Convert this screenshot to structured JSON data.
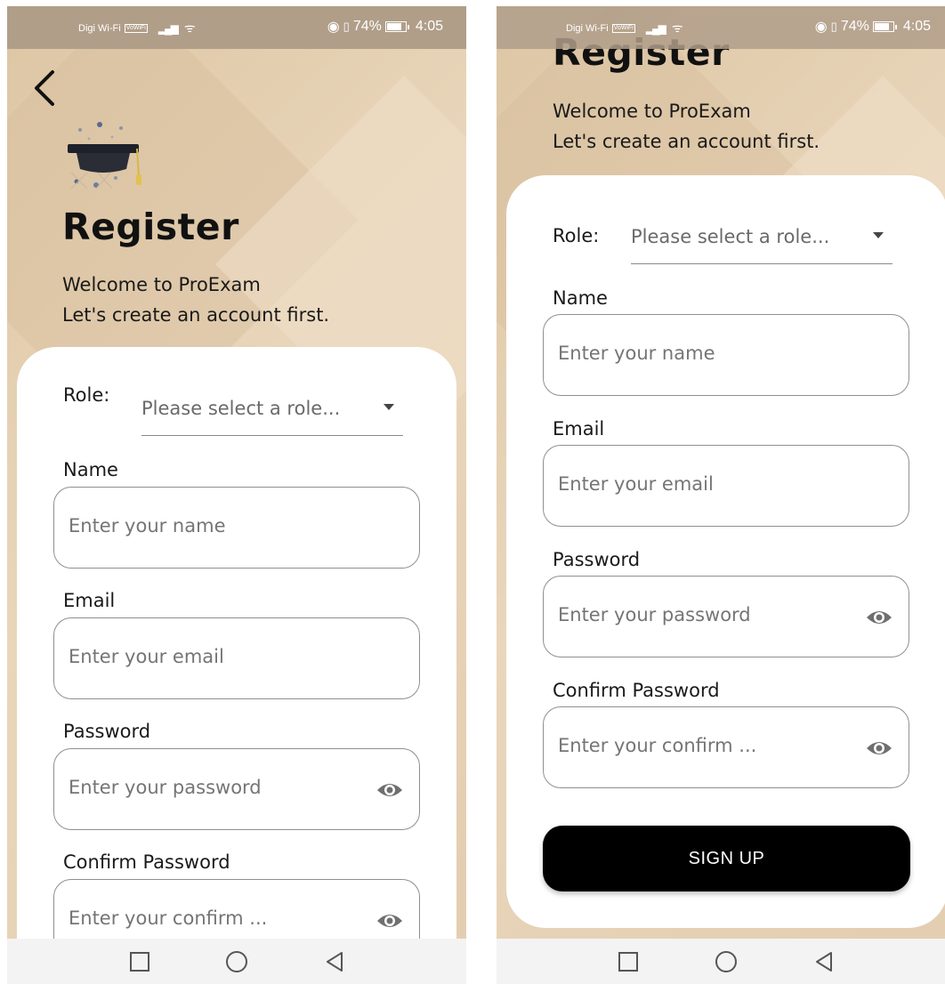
{
  "status_bar": {
    "carrier": "Digi Wi-Fi",
    "vowifi_badge": "VoWiFi",
    "battery": "74%",
    "time": "4:05"
  },
  "header": {
    "title": "Register",
    "subtitle_line1": "Welcome to ProExam",
    "subtitle_line2": "Let's create an account first."
  },
  "form": {
    "role_label": "Role:",
    "role_placeholder": "Please select a role...",
    "name_label": "Name",
    "name_placeholder": "Enter your name",
    "email_label": "Email",
    "email_placeholder": "Enter your email",
    "password_label": "Password",
    "password_placeholder": "Enter your password",
    "confirm_label": "Confirm Password",
    "confirm_placeholder": "Enter your confirm ...",
    "signup_label": "SIGN UP"
  },
  "icons": {
    "back": "chevron-left-icon",
    "logo": "graduation-cap-icon",
    "eye": "eye-icon",
    "nav_recents": "square-icon",
    "nav_home": "circle-icon",
    "nav_back": "triangle-back-icon"
  },
  "colors": {
    "background": "#e8d5b9",
    "status_bar": "#b09e89",
    "card": "#ffffff",
    "button": "#000000",
    "nav_bar": "#f3f3f3"
  }
}
